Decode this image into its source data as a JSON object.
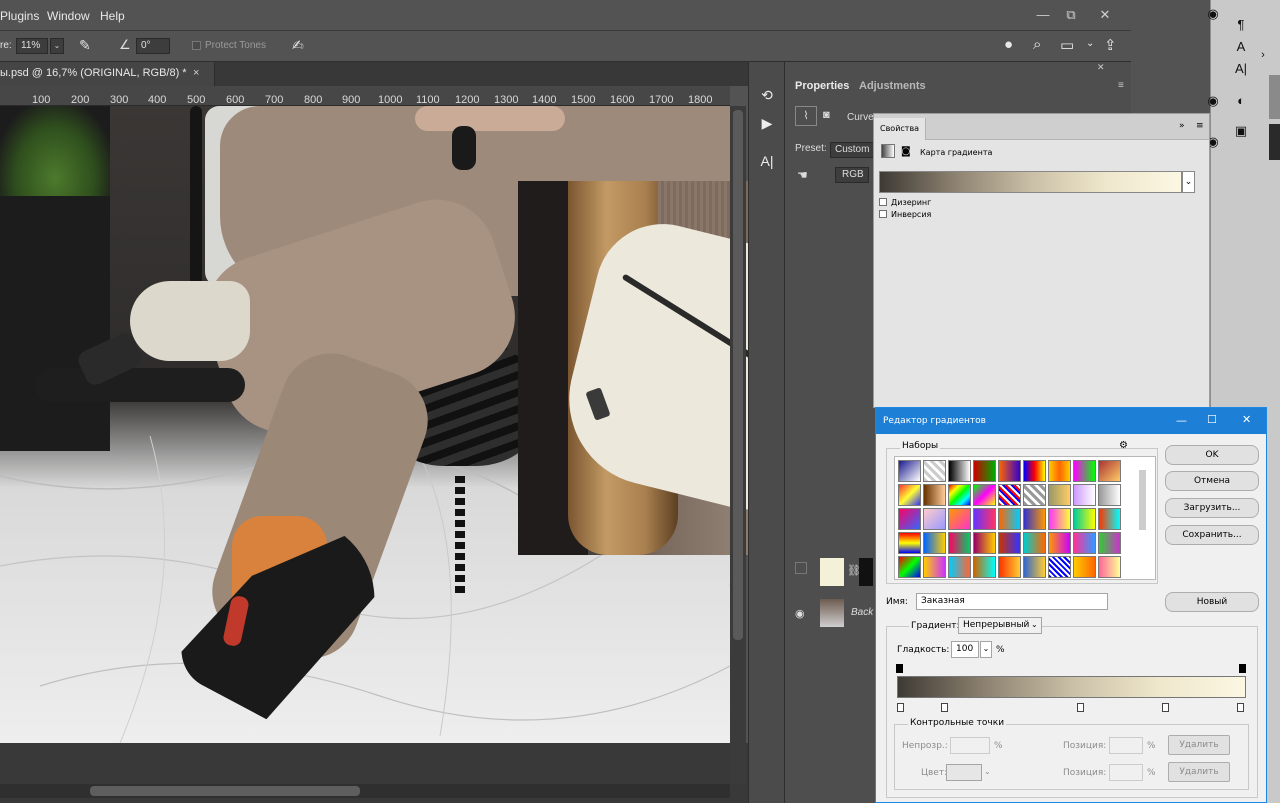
{
  "menu": {
    "items": [
      "Plugins",
      "Window",
      "Help"
    ]
  },
  "window_controls": {
    "minimize": "—",
    "restore": "⧉",
    "close": "✕"
  },
  "options_bar": {
    "exposure_label": "re:",
    "exposure_value": "11%",
    "angle_value": "0°",
    "protect_tones_label": "Protect Tones"
  },
  "document_tab": {
    "title": "ы.psd @ 16,7% (ORIGINAL, RGB/8) *",
    "close": "×"
  },
  "ruler": {
    "ticks": [
      "100",
      "200",
      "300",
      "400",
      "500",
      "600",
      "700",
      "800",
      "900",
      "1000",
      "1100",
      "1200",
      "1300",
      "1400",
      "1500",
      "1600",
      "1700",
      "1800"
    ]
  },
  "properties_panel": {
    "tabs": [
      "Properties",
      "Adjustments"
    ],
    "curves_label": "Curve",
    "preset_label": "Preset:",
    "preset_value": "Custom",
    "channel_value": "RGB"
  },
  "layers": {
    "background_label": "Back"
  },
  "svoistva_panel": {
    "title": "Свойства",
    "adjustment_name": "Карта градиента",
    "dithering_label": "Дизеринг",
    "inversion_label": "Инверсия",
    "gradient_colors": [
      "#3e3a34",
      "#8d8270",
      "#c9bfa6",
      "#efe7cc",
      "#fbf7e3"
    ]
  },
  "gradient_editor": {
    "title": "Редактор градиентов",
    "presets_label": "Наборы",
    "buttons": {
      "ok": "OK",
      "cancel": "Отмена",
      "load": "Загрузить...",
      "save": "Сохранить...",
      "new": "Новый"
    },
    "name_label": "Имя:",
    "name_value": "Заказная",
    "gradient_type_label": "Градиент:",
    "gradient_type_value": "Непрерывный",
    "smoothness_label": "Гладкость:",
    "smoothness_value": "100",
    "smoothness_unit": "%",
    "stops_group_label": "Контрольные точки",
    "opacity_label": "Непрозр.:",
    "position_label": "Позиция:",
    "color_label": "Цвет:",
    "percent": "%",
    "delete_label": "Удалить",
    "color_stops_positions": [
      0,
      0.13,
      0.53,
      0.78,
      1.0
    ]
  },
  "accent_colors": {
    "title_bar": "#1e7fd6",
    "ps_dark": "#535353"
  }
}
